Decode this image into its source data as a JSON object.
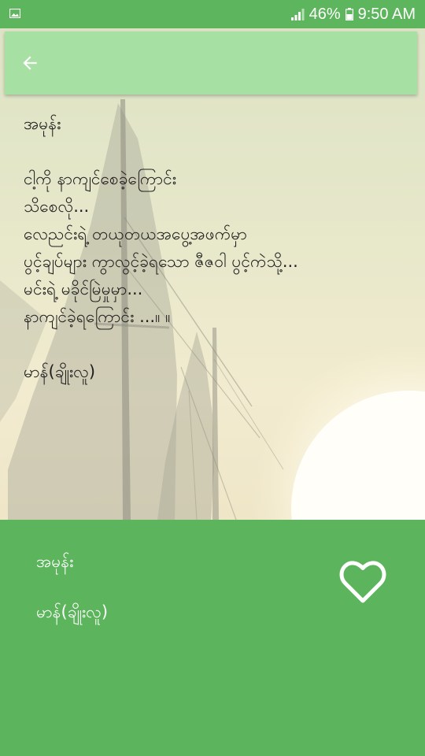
{
  "status_bar": {
    "battery_percent": "46%",
    "time": "9:50 AM",
    "icons": [
      "gallery-icon",
      "signal-icon",
      "battery-icon"
    ]
  },
  "app_bar": {
    "back_icon": "arrow-left-icon"
  },
  "poem": {
    "title": "အမုန်း",
    "lines": [
      "ငါ့ကို နာကျင်စေခဲ့ကြောင်း",
      "သိစေလို...",
      "လေညင်းရဲ့ တယုတယအပွေ့အဖက်မှာ",
      "ပွင့်ချပ်များ ကွာလွင့်ခဲ့ရသော ဇီဇဝါ ပွင့်ကဲသို့...",
      "မင်းရဲ့ မခိုင်မြဲမှုမှာ...",
      "နာကျင်ခဲ့ရကြောင်း ...။ ။"
    ],
    "author": "မာန်(ချိုးလူ)"
  },
  "info_panel": {
    "title": "အမုန်း",
    "author": "မာန်(ချိုးလူ)",
    "favorite_icon": "heart-outline-icon"
  },
  "colors": {
    "status_bar": "#5db55d",
    "app_bar": "#a7e0a3",
    "panel": "#5cb55c",
    "text_dark": "#1e1e1e",
    "text_light": "#ffffff"
  }
}
